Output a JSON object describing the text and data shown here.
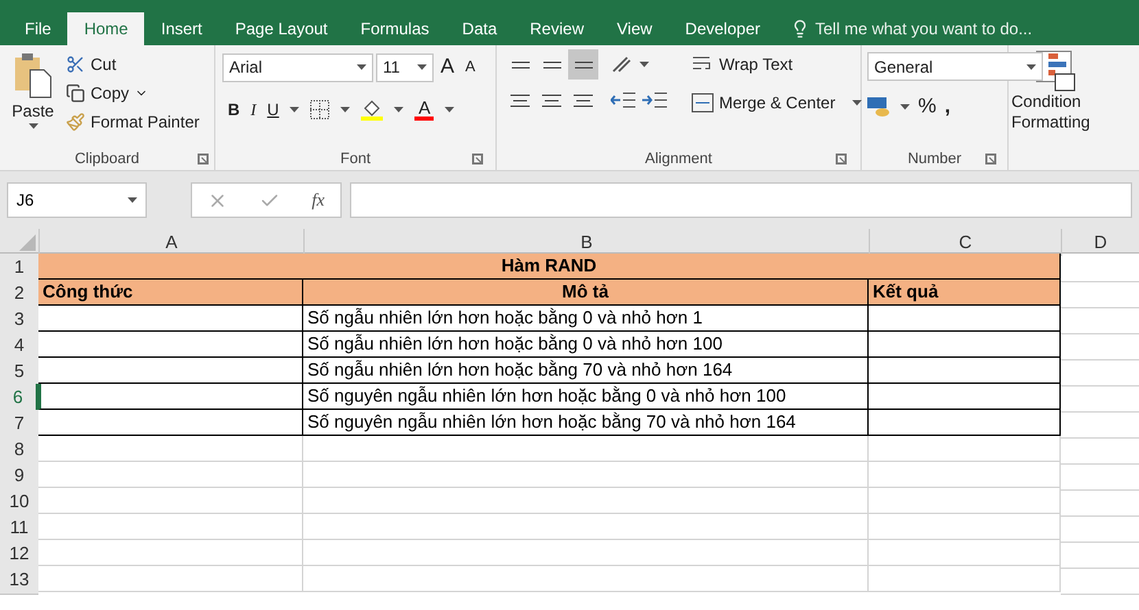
{
  "tabs": [
    {
      "label": "File",
      "selected": false
    },
    {
      "label": "Home",
      "selected": true
    },
    {
      "label": "Insert",
      "selected": false
    },
    {
      "label": "Page Layout",
      "selected": false
    },
    {
      "label": "Formulas",
      "selected": false
    },
    {
      "label": "Data",
      "selected": false
    },
    {
      "label": "Review",
      "selected": false
    },
    {
      "label": "View",
      "selected": false
    },
    {
      "label": "Developer",
      "selected": false
    }
  ],
  "tell_me": "Tell me what you want to do...",
  "clipboard": {
    "paste": "Paste",
    "cut": "Cut",
    "copy": "Copy",
    "format_painter": "Format Painter",
    "label": "Clipboard"
  },
  "font": {
    "name": "Arial",
    "size": "11",
    "grow": "A",
    "shrink": "A",
    "bold": "B",
    "italic": "I",
    "underline": "U",
    "color_letter": "A",
    "label": "Font"
  },
  "alignment": {
    "vertical": [
      {
        "selected": false
      },
      {
        "selected": false
      },
      {
        "selected": true
      }
    ],
    "wrap_text": "Wrap Text",
    "merge_center": "Merge & Center",
    "label": "Alignment"
  },
  "number": {
    "format": "General",
    "percent": "%",
    "comma": ",",
    "label": "Number"
  },
  "styles": {
    "conditional_formatting": [
      "Condition",
      "Formatting"
    ]
  },
  "formula_bar": {
    "name_box": "J6",
    "fx": "fx"
  },
  "sheet": {
    "columns": [
      "A",
      "B",
      "C",
      "D"
    ],
    "rows": [
      {
        "number": "1",
        "active": false,
        "kind": "title",
        "text": "Hàm RAND"
      },
      {
        "number": "2",
        "active": false,
        "kind": "header",
        "cells": [
          "Công thức",
          "Mô tả",
          "Kết quả"
        ]
      },
      {
        "number": "3",
        "active": false,
        "kind": "data",
        "text": "Số ngẫu nhiên lớn hơn hoặc bằng 0 và nhỏ hơn 1"
      },
      {
        "number": "4",
        "active": false,
        "kind": "data",
        "text": "Số ngẫu nhiên lớn hơn hoặc bằng 0 và nhỏ hơn 100"
      },
      {
        "number": "5",
        "active": false,
        "kind": "data",
        "text": "Số ngẫu nhiên lớn hơn hoặc bằng 70 và nhỏ hơn 164"
      },
      {
        "number": "6",
        "active": true,
        "kind": "data",
        "text": "Số nguyên ngẫu nhiên lớn hơn hoặc bằng 0 và nhỏ hơn 100"
      },
      {
        "number": "7",
        "active": false,
        "kind": "data",
        "text": "Số nguyên ngẫu nhiên lớn hơn hoặc bằng 70 và nhỏ hơn 164"
      },
      {
        "number": "8",
        "active": false,
        "kind": "empty"
      },
      {
        "number": "9",
        "active": false,
        "kind": "empty"
      },
      {
        "number": "10",
        "active": false,
        "kind": "empty"
      },
      {
        "number": "11",
        "active": false,
        "kind": "empty"
      },
      {
        "number": "12",
        "active": false,
        "kind": "empty"
      },
      {
        "number": "13",
        "active": false,
        "kind": "empty"
      }
    ]
  }
}
